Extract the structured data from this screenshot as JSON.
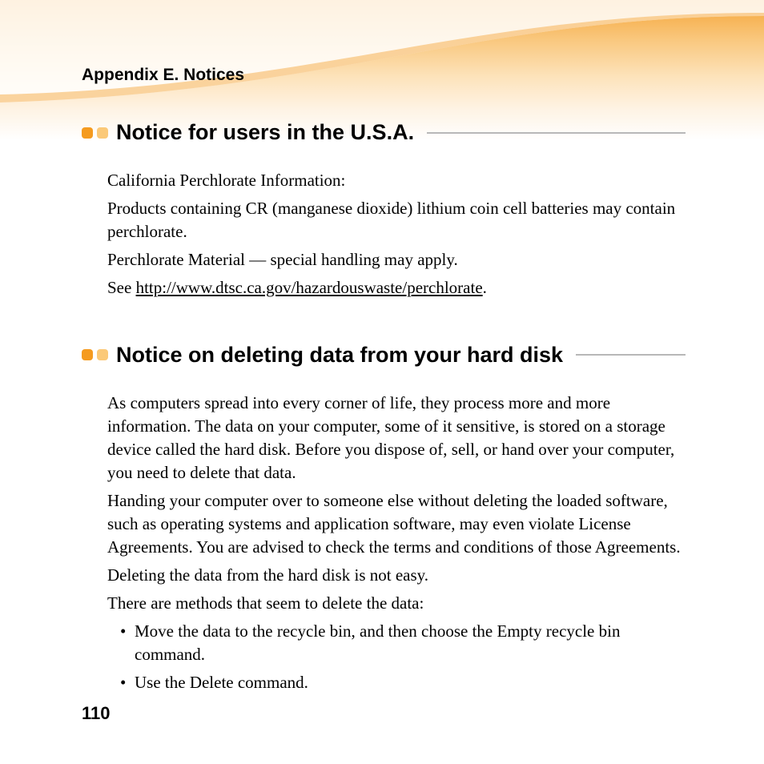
{
  "header": {
    "title": "Appendix E. Notices"
  },
  "section1": {
    "heading": "Notice for users in the U.S.A.",
    "p1": "California Perchlorate Information:",
    "p2": "Products containing CR (manganese dioxide) lithium coin cell batteries may contain perchlorate.",
    "p3": "Perchlorate Material — special handling may apply.",
    "p4_pre": "See ",
    "p4_link": "http://www.dtsc.ca.gov/hazardouswaste/perchlorate",
    "p4_post": "."
  },
  "section2": {
    "heading": "Notice on deleting data from your hard disk",
    "p1": "As computers spread into every corner of life, they process more and more information. The data on your computer, some of it sensitive, is stored on a storage device called the hard disk. Before you dispose of, sell, or hand over your computer, you need to delete that data.",
    "p2": "Handing your computer over to someone else without deleting the loaded software, such as operating systems and application software, may even violate License Agreements. You are advised to check the terms and conditions of those Agreements.",
    "p3": "Deleting the data from the hard disk is not easy.",
    "p4": "There are methods that seem to delete the data:",
    "bullets": [
      "Move the data to the recycle bin, and then choose the Empty recycle bin command.",
      "Use the Delete command."
    ]
  },
  "page_number": "110"
}
